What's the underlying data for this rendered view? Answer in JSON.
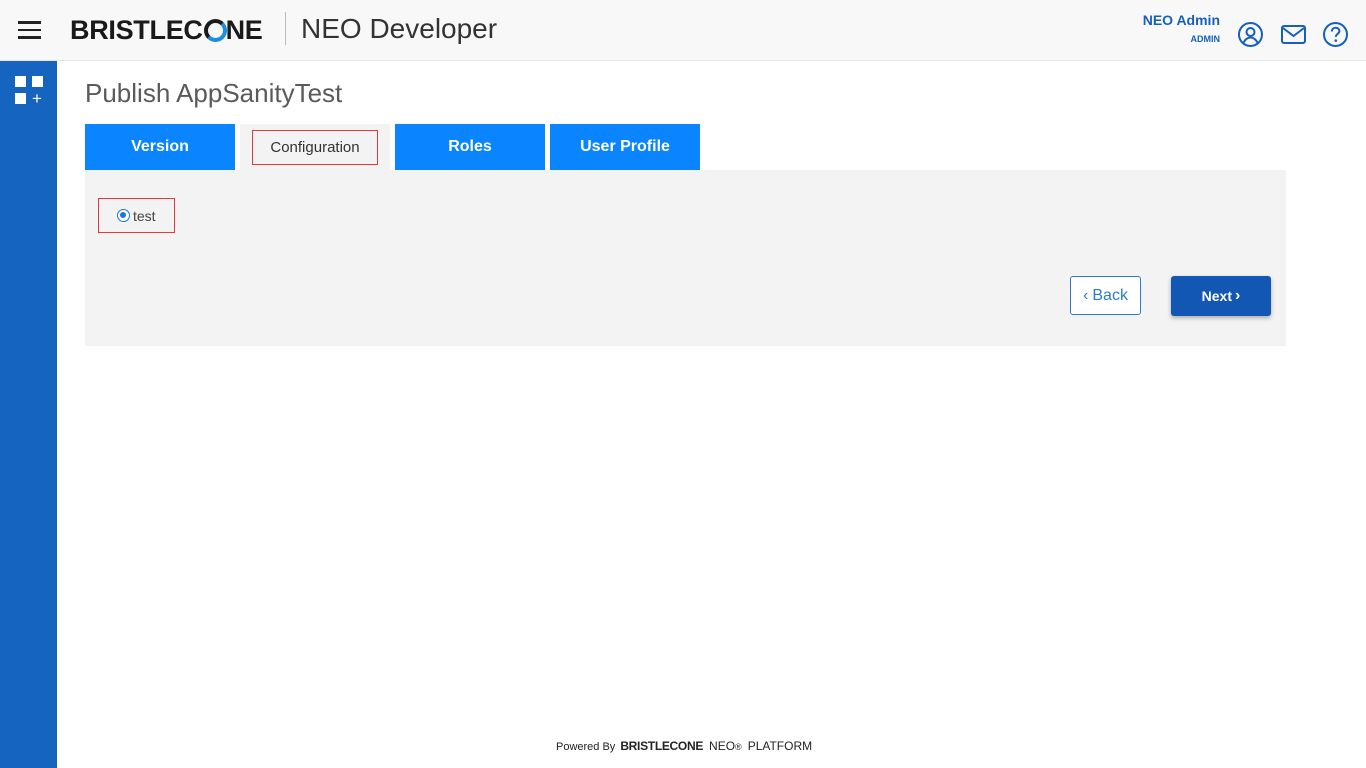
{
  "header": {
    "brand": "BRISTLECONE",
    "app_title": "NEO Developer",
    "user_name": "NEO Admin",
    "user_role": "ADMIN",
    "icons": [
      "hamburger-menu-icon",
      "user-profile-icon",
      "mail-icon",
      "help-icon"
    ]
  },
  "sidebar": {
    "icons": [
      "apps-add-icon"
    ],
    "color": "#1565c0"
  },
  "main": {
    "page_title": "Publish AppSanityTest",
    "tabs": [
      {
        "label": "Version",
        "active": false
      },
      {
        "label": "Configuration",
        "active": true
      },
      {
        "label": "Roles",
        "active": false
      },
      {
        "label": "User Profile",
        "active": false
      }
    ],
    "configuration": {
      "option_label": "test",
      "selected": true
    },
    "buttons": {
      "back": "Back",
      "next": "Next"
    }
  },
  "footer": {
    "powered_by": "Powered By",
    "brand": "BRISTLECONE",
    "neo": "NEO",
    "registered": "®",
    "platform": "PLATFORM"
  },
  "colors": {
    "accent_blue": "#0a84ff",
    "primary_button": "#1257b3",
    "highlight_border": "#e53935"
  }
}
